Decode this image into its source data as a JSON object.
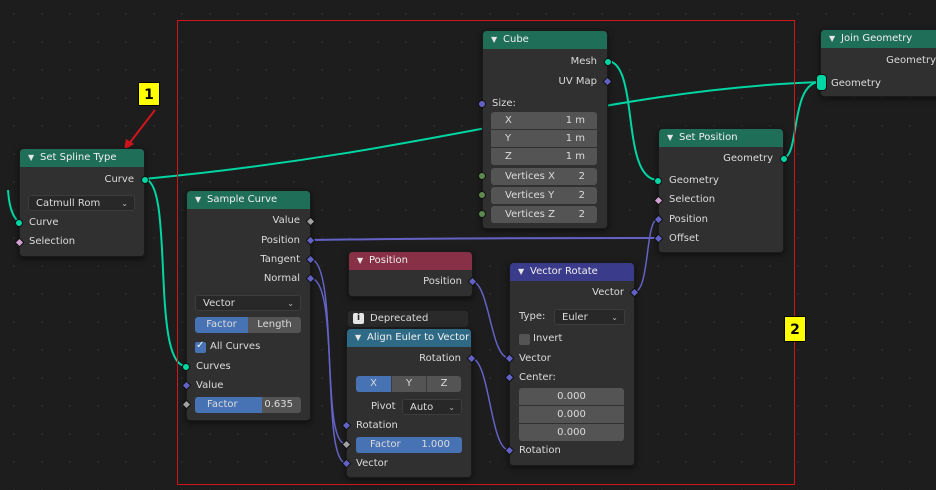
{
  "annotations": {
    "marker_1": "1",
    "marker_2": "2"
  },
  "join_geometry": {
    "title": "Join Geometry",
    "out_geometry": "Geometry",
    "in_geometry": "Geometry"
  },
  "set_spline_type": {
    "title": "Set Spline Type",
    "out_curve": "Curve",
    "type_value": "Catmull Rom",
    "in_curve": "Curve",
    "in_selection": "Selection"
  },
  "cube": {
    "title": "Cube",
    "out_mesh": "Mesh",
    "out_uvmap": "UV Map",
    "size_label": "Size:",
    "size": [
      {
        "axis": "X",
        "value": "1 m"
      },
      {
        "axis": "Y",
        "value": "1 m"
      },
      {
        "axis": "Z",
        "value": "1 m"
      }
    ],
    "vertices": [
      {
        "label": "Vertices X",
        "value": "2"
      },
      {
        "label": "Vertices Y",
        "value": "2"
      },
      {
        "label": "Vertices Z",
        "value": "2"
      }
    ]
  },
  "set_position": {
    "title": "Set Position",
    "out_geometry": "Geometry",
    "in_geometry": "Geometry",
    "in_selection": "Selection",
    "in_position": "Position",
    "in_offset": "Offset"
  },
  "sample_curve": {
    "title": "Sample Curve",
    "out_value": "Value",
    "out_position": "Position",
    "out_tangent": "Tangent",
    "out_normal": "Normal",
    "data_type": "Vector",
    "mode_factor": "Factor",
    "mode_length": "Length",
    "all_curves": "All Curves",
    "in_curves": "Curves",
    "in_value": "Value",
    "factor_label": "Factor",
    "factor_value": "0.635",
    "factor_fraction": 0.635
  },
  "position": {
    "title": "Position",
    "out_position": "Position"
  },
  "align_euler": {
    "deprecated": "Deprecated",
    "deprecated_icon_glyph": "i",
    "title": "Align Euler to Vector",
    "out_rotation": "Rotation",
    "axis": [
      "X",
      "Y",
      "Z"
    ],
    "pivot_label": "Pivot",
    "pivot_value": "Auto",
    "in_rotation": "Rotation",
    "factor_label": "Factor",
    "factor_value": "1.000",
    "factor_fraction": 1.0,
    "in_vector": "Vector"
  },
  "vector_rotate": {
    "title": "Vector Rotate",
    "out_vector": "Vector",
    "type_label": "Type:",
    "type_value": "Euler",
    "invert_label": "Invert",
    "in_vector": "Vector",
    "center_label": "Center:",
    "center": [
      "0.000",
      "0.000",
      "0.000"
    ],
    "in_rotation": "Rotation"
  },
  "colors": {
    "geometry": "#00d6a3",
    "vector": "#6363c7",
    "frame": "#d0151c",
    "marker": "#ffff00"
  }
}
